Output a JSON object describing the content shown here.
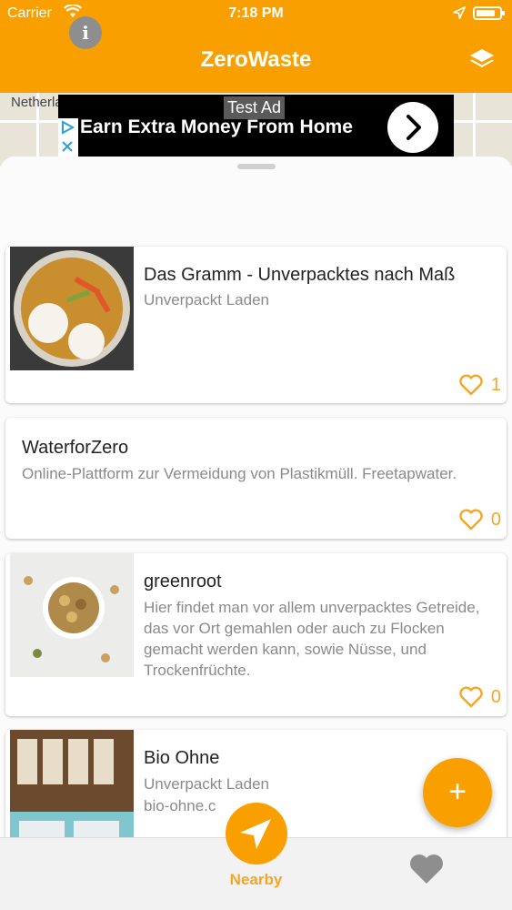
{
  "status_bar": {
    "carrier": "Carrier",
    "time": "7:18 PM",
    "battery_level": 0.85
  },
  "nav": {
    "title": "ZeroWaste",
    "layers_icon": "layers-icon"
  },
  "map": {
    "label": "Netherla"
  },
  "ad": {
    "label": "Test Ad",
    "headline": "Earn Extra Money From Home"
  },
  "places": [
    {
      "name": "Das Gramm - Unverpacktes nach Maß",
      "desc": "Unverpackt Laden",
      "likes": "1",
      "has_image": true,
      "image": "food-bowl"
    },
    {
      "name": "WaterforZero",
      "desc": "Online-Plattform zur Vermeidung von Plastikmüll. Freetapwater.",
      "likes": "0",
      "has_image": false
    },
    {
      "name": "greenroot",
      "desc": "Hier findet man vor allem unverpacktes Getreide, das vor Ort gemahlen oder auch zu Flocken gemacht werden kann, sowie Nüsse, und Trockenfrüchte.",
      "likes": "0",
      "has_image": true,
      "image": "nuts-bowl"
    },
    {
      "name": "Bio Ohne",
      "desc": "Unverpackt Laden",
      "desc2": "bio-ohne.c",
      "has_image": true,
      "image": "shop-shelves"
    }
  ],
  "tabs": {
    "info": "i",
    "nearby": "Nearby"
  },
  "colors": {
    "accent": "#f9a000",
    "heart": "#f5a623"
  }
}
